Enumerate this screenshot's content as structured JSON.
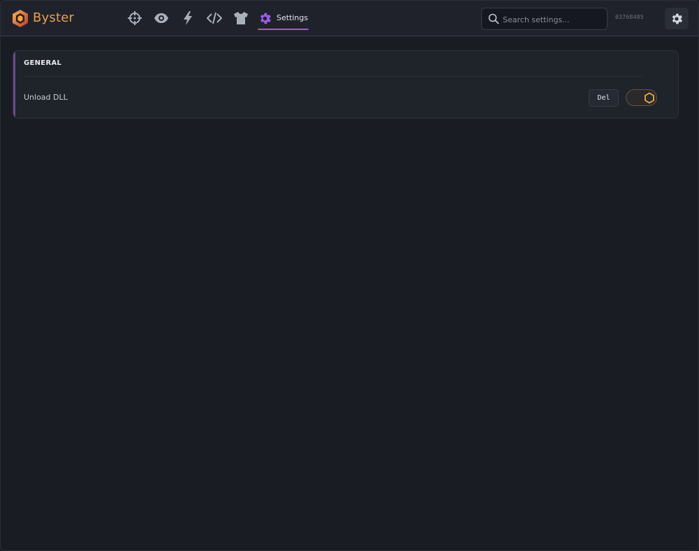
{
  "app": {
    "brand": "Byster",
    "hwid": "03768485"
  },
  "nav": {
    "items": [
      {
        "name": "aimbot",
        "icon": "crosshair-icon"
      },
      {
        "name": "visuals",
        "icon": "eye-icon"
      },
      {
        "name": "misc",
        "icon": "lightning-icon"
      },
      {
        "name": "scripts",
        "icon": "code-icon"
      },
      {
        "name": "skins",
        "icon": "tshirt-icon"
      }
    ],
    "active": {
      "icon": "gear-icon",
      "label": "Settings"
    }
  },
  "search": {
    "placeholder": "Search settings..."
  },
  "panel": {
    "title": "GENERAL",
    "rows": [
      {
        "label": "Unload DLL",
        "keybind": "Del",
        "enabled": true
      }
    ]
  },
  "colors": {
    "accent_purple": "#9b5de5",
    "brand_orange": "#e8a04c",
    "background": "#181b22"
  }
}
